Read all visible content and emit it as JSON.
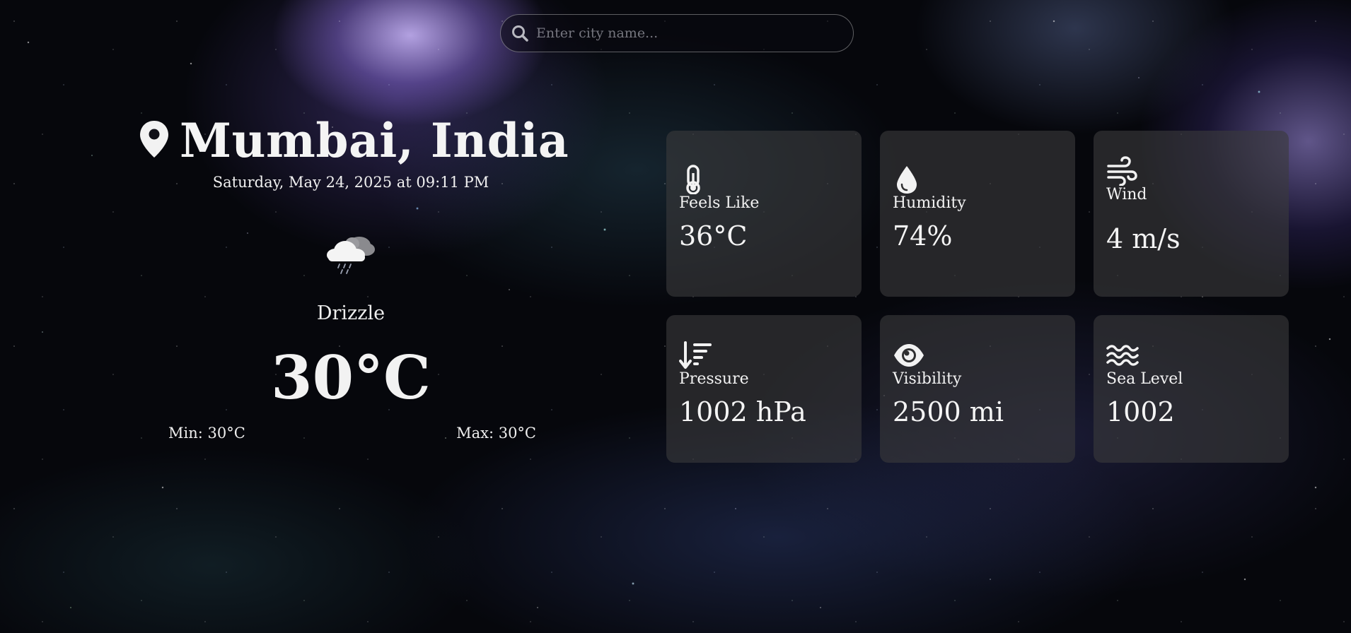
{
  "search": {
    "placeholder": "Enter city name..."
  },
  "location": {
    "city": "Mumbai, India",
    "datetime": "Saturday, May 24, 2025 at 09:11 PM"
  },
  "current": {
    "condition": "Drizzle",
    "temperature": "30°C",
    "min_label": "Min: 30°C",
    "max_label": "Max: 30°C",
    "icon": "cloud-drizzle-icon"
  },
  "details": [
    {
      "icon": "thermometer-icon",
      "label": "Feels Like",
      "value": "36°C"
    },
    {
      "icon": "droplet-icon",
      "label": "Humidity",
      "value": "74%"
    },
    {
      "icon": "wind-icon",
      "label": "Wind",
      "value": "4 m/s"
    },
    {
      "icon": "pressure-icon",
      "label": "Pressure",
      "value": "1002 hPa"
    },
    {
      "icon": "eye-icon",
      "label": "Visibility",
      "value": "2500 mi"
    },
    {
      "icon": "water-waves-icon",
      "label": "Sea Level",
      "value": "1002"
    }
  ],
  "colors": {
    "text": "#f2f2f2",
    "card_bg": "#3a3a3c",
    "background": "#06070c"
  }
}
